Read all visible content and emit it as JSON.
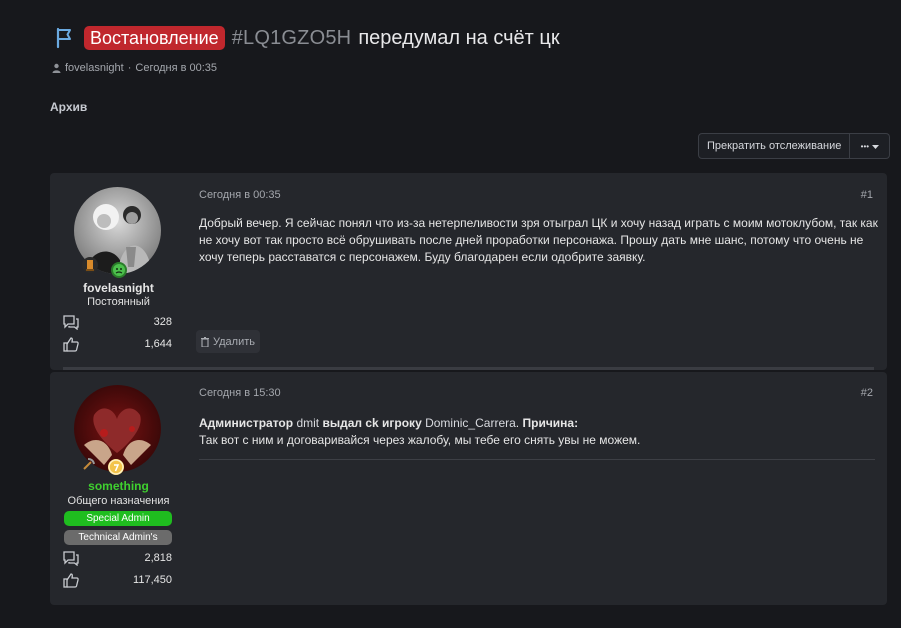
{
  "thread": {
    "prefix": "Востановление",
    "tag": "#LQ1GZO5H",
    "title": "передумал на счёт цк",
    "author": "fovelasnight",
    "separator": "·",
    "date": "Сегодня в 00:35",
    "archive": "Архив"
  },
  "actions": {
    "unwatch_label": "Прекратить отслеживание",
    "more_label": "•••"
  },
  "colors": {
    "prefix_bg": "#c0272d",
    "special_admin": "#1fbd1f",
    "technical_admin": "#6b6b6b",
    "username_green": "#3fcf2f",
    "page_bg": "#17181c",
    "post_bg": "#25272c"
  },
  "posts": [
    {
      "username": "fovelasnight",
      "user_title": "Постоянный",
      "stats": {
        "messages": "328",
        "reactions": "1,644"
      },
      "date": "Сегодня в 00:35",
      "number": "#1",
      "body": "Добрый вечер. Я сейчас понял что из-за нетерпеливости зря отыграл ЦК и хочу назад играть с моим мотоклубом, так как не хочу вот так просто всё обрушивать после дней проработки персонажа. Прошу дать мне шанс, потому что очень не хочу теперь расставатся с персонажем. Буду благодарен если одобрите заявку.",
      "delete_label": "Удалить",
      "icons": [
        "message-icon",
        "like-icon",
        "trash-icon"
      ]
    },
    {
      "username": "something",
      "user_title": "Общего назначения",
      "banners": [
        "Special Admin",
        "Technical Admin's"
      ],
      "stats": {
        "messages": "2,818",
        "reactions": "117,450"
      },
      "date": "Сегодня в 15:30",
      "number": "#2",
      "body": {
        "admin_word": "Администратор",
        "admin_name": "dmit",
        "action": "выдал ck игроку",
        "player": "Dominic_Carrera",
        "reason_label": "Причина:",
        "reason_text": "Так вот с ним и договаривайся через жалобу, мы тебе его снять увы не можем."
      }
    }
  ]
}
